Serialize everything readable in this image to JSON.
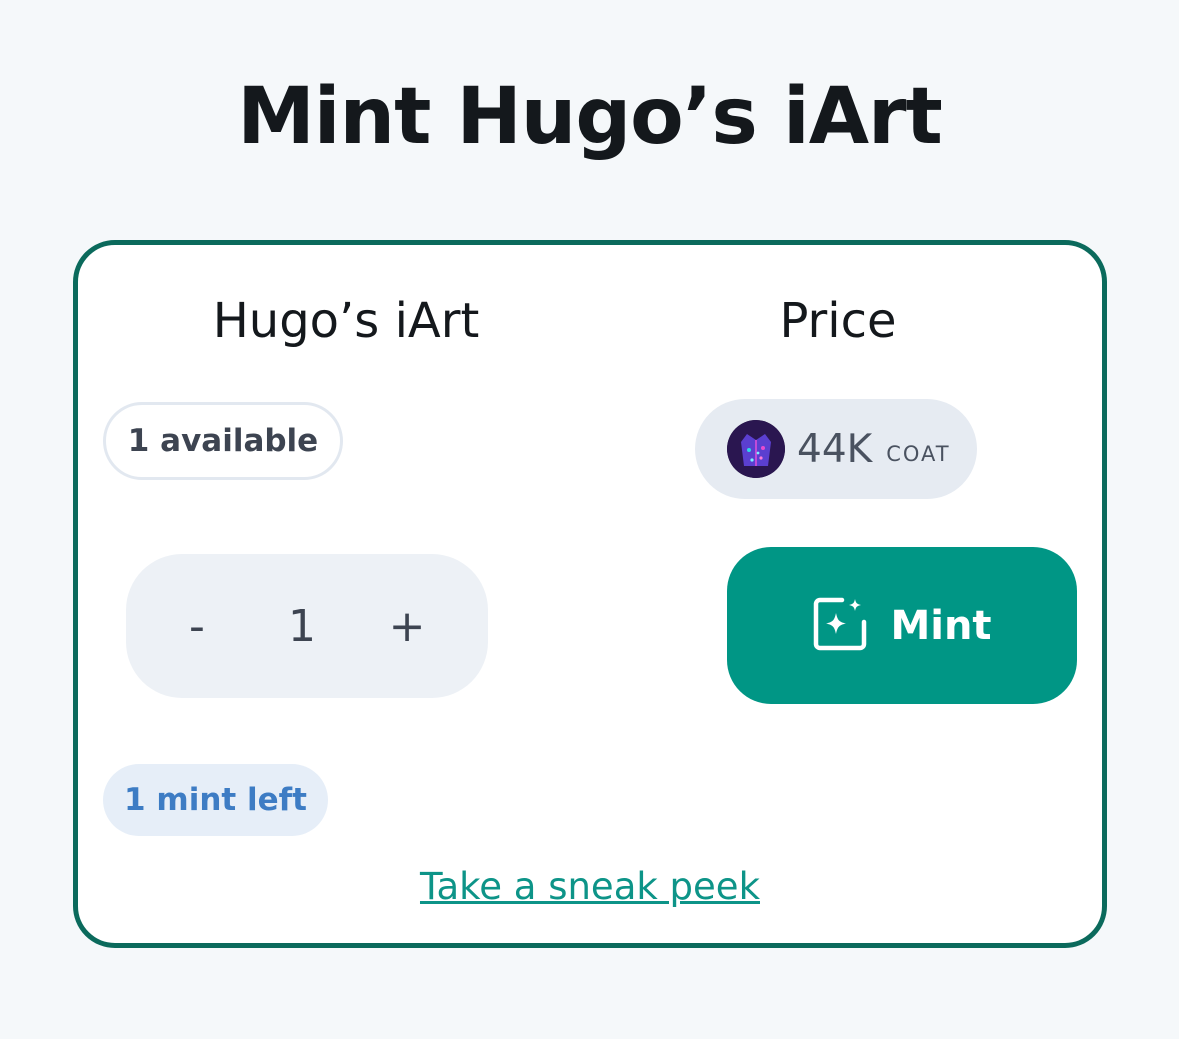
{
  "page": {
    "title": "Mint Hugo’s iArt"
  },
  "card": {
    "collection_heading": "Hugo’s iArt",
    "price_heading": "Price",
    "available_badge": "1 available",
    "price": {
      "amount": "44K",
      "unit": "COAT",
      "token_icon": "coat-token-icon"
    },
    "quantity": {
      "minus_label": "-",
      "value": "1",
      "plus_label": "+"
    },
    "mint_button": {
      "label": "Mint",
      "icon": "sparkle-image-icon"
    },
    "mints_left_badge": "1 mint left",
    "sneak_peek_link": "Take a sneak peek"
  },
  "colors": {
    "accent": "#009685",
    "card_border": "#0b6a5c",
    "link": "#0d9488",
    "mints_left_text": "#3d7cc4",
    "background": "#f5f8fa"
  }
}
